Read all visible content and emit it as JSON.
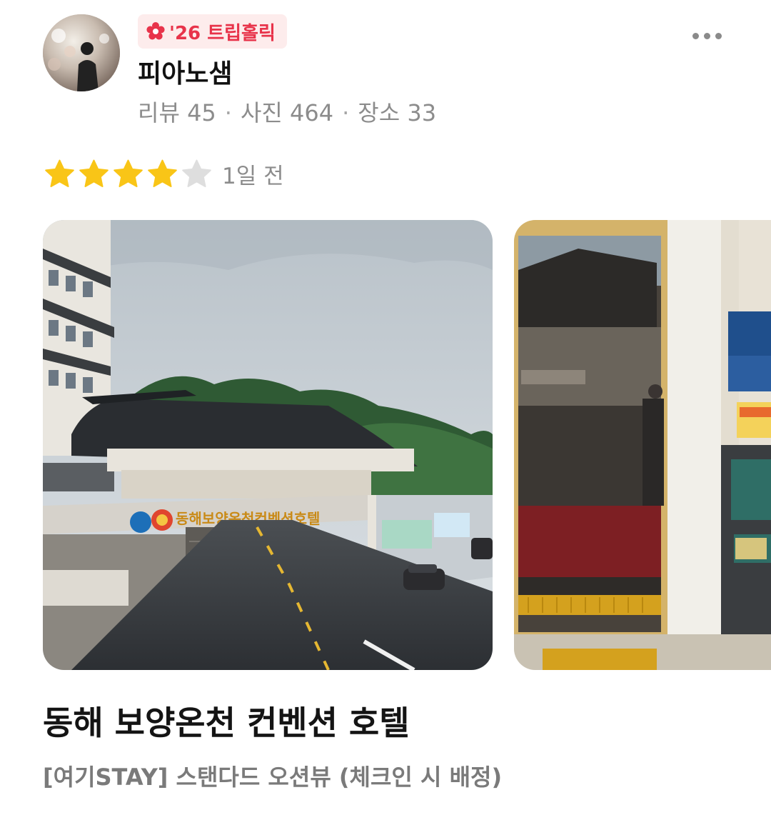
{
  "reviewer": {
    "badge_label": "'26 트립홀릭",
    "name": "피아노샘",
    "stats": [
      {
        "label": "리뷰",
        "value": "45"
      },
      {
        "label": "사진",
        "value": "464"
      },
      {
        "label": "장소",
        "value": "33"
      }
    ]
  },
  "review": {
    "rating": 4,
    "max_rating": 5,
    "time_ago": "1일 전"
  },
  "photos": [
    {
      "sign_text": "동해보양온천컨벤션호텔"
    },
    {
      "sign_text": ""
    }
  ],
  "place": {
    "name": "동해 보양온천 컨벤션 호텔",
    "room_type": "[여기STAY] 스탠다드 오션뷰 (체크인 시 배정)"
  },
  "icons": {
    "badge": "flower-badge-icon",
    "more": "more-dots-icon",
    "star": "star-icon"
  },
  "colors": {
    "badge_text": "#e8334a",
    "badge_bg": "#fdecec",
    "star_filled": "#f9c517",
    "star_empty": "#dedede",
    "secondary_text": "#8c8c8c"
  }
}
